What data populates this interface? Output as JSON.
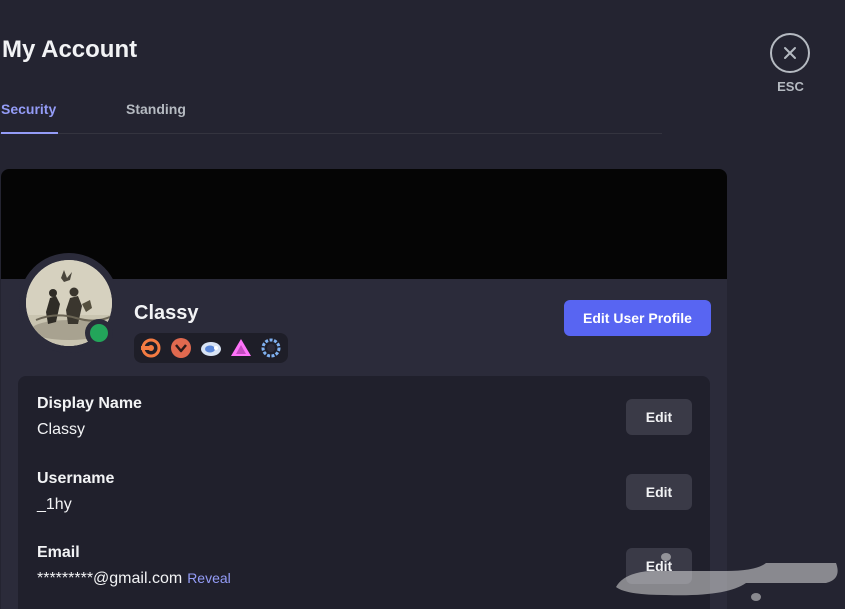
{
  "page": {
    "title": "My Account"
  },
  "tabs": [
    {
      "label": "Security",
      "active": true
    },
    {
      "label": "Standing",
      "active": false
    }
  ],
  "close": {
    "label": "ESC",
    "icon": "close-icon"
  },
  "profile": {
    "display_name": "Classy",
    "status": "online",
    "status_color": "#23a55a",
    "edit_profile_label": "Edit User Profile",
    "badges": [
      "hypesquad-icon",
      "nitro-icon",
      "quest-icon",
      "boost-icon",
      "laurel-icon"
    ]
  },
  "fields": [
    {
      "label": "Display Name",
      "value": "Classy",
      "edit_label": "Edit"
    },
    {
      "label": "Username",
      "value": "_1hy",
      "edit_label": "Edit"
    },
    {
      "label": "Email",
      "value": "*********@gmail.com",
      "reveal_label": "Reveal",
      "edit_label": "Edit"
    }
  ],
  "watermark": {
    "text": "حراج"
  },
  "colors": {
    "background": "#242431",
    "card": "#2b2b3a",
    "accent": "#5865f2",
    "tab_active": "#949cf7"
  }
}
